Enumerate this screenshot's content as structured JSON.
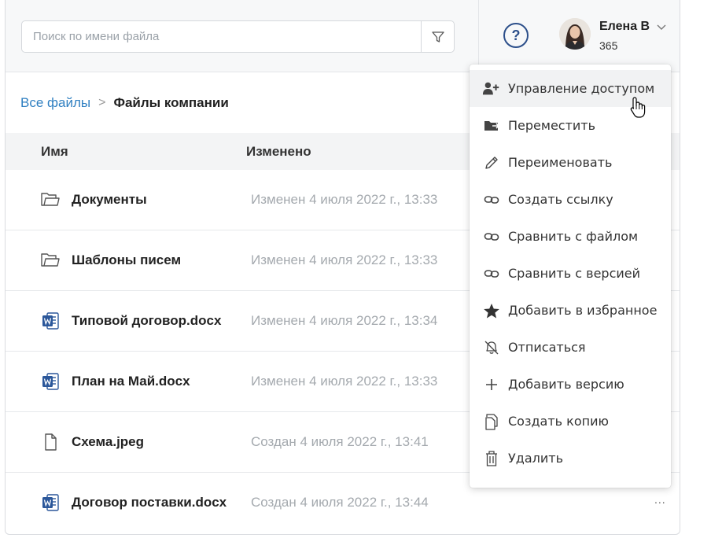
{
  "search": {
    "placeholder": "Поиск по имени файла",
    "value": ""
  },
  "header": {
    "user_name": "Елена В",
    "user_sub": "365",
    "help_label": "?"
  },
  "breadcrumb": {
    "root": "Все файлы",
    "separator": ">",
    "current": "Файлы компании"
  },
  "table": {
    "columns": [
      "Имя",
      "Изменено"
    ],
    "rows": [
      {
        "icon": "folder-icon",
        "name": "Документы",
        "modified": "Изменен 4 июля 2022 г., 13:33"
      },
      {
        "icon": "folder-icon",
        "name": "Шаблоны писем",
        "modified": "Изменен 4 июля 2022 г., 13:33"
      },
      {
        "icon": "word-doc-icon",
        "name": "Типовой договор.docx",
        "modified": "Изменен 4 июля 2022 г., 13:34"
      },
      {
        "icon": "word-doc-icon",
        "name": "План на Май.docx",
        "modified": "Изменен 4 июля 2022 г., 13:33"
      },
      {
        "icon": "file-icon",
        "name": "Схема.jpeg",
        "modified": "Создан 4 июля 2022 г., 13:41"
      },
      {
        "icon": "word-doc-icon",
        "name": "Договор поставки.docx",
        "modified": "Создан 4 июля 2022 г., 13:44"
      }
    ],
    "more_label": "..."
  },
  "context_menu": {
    "items": [
      {
        "icon": "user-plus-icon",
        "label": "Управление доступом"
      },
      {
        "icon": "move-folder-icon",
        "label": "Переместить"
      },
      {
        "icon": "pencil-icon",
        "label": "Переименовать"
      },
      {
        "icon": "link-icon",
        "label": "Создать ссылку"
      },
      {
        "icon": "link-icon",
        "label": "Сравнить с файлом"
      },
      {
        "icon": "link-icon",
        "label": "Сравнить с версией"
      },
      {
        "icon": "star-icon",
        "label": "Добавить в избранное"
      },
      {
        "icon": "bell-off-icon",
        "label": "Отписаться"
      },
      {
        "icon": "plus-icon",
        "label": "Добавить версию"
      },
      {
        "icon": "copy-icon",
        "label": "Создать копию"
      },
      {
        "icon": "trash-icon",
        "label": "Удалить"
      }
    ]
  },
  "colors": {
    "link": "#2f7fc1",
    "help_icon": "#2c4f8a",
    "word_icon": "#2b579a",
    "muted_text": "#a4a9ae"
  }
}
